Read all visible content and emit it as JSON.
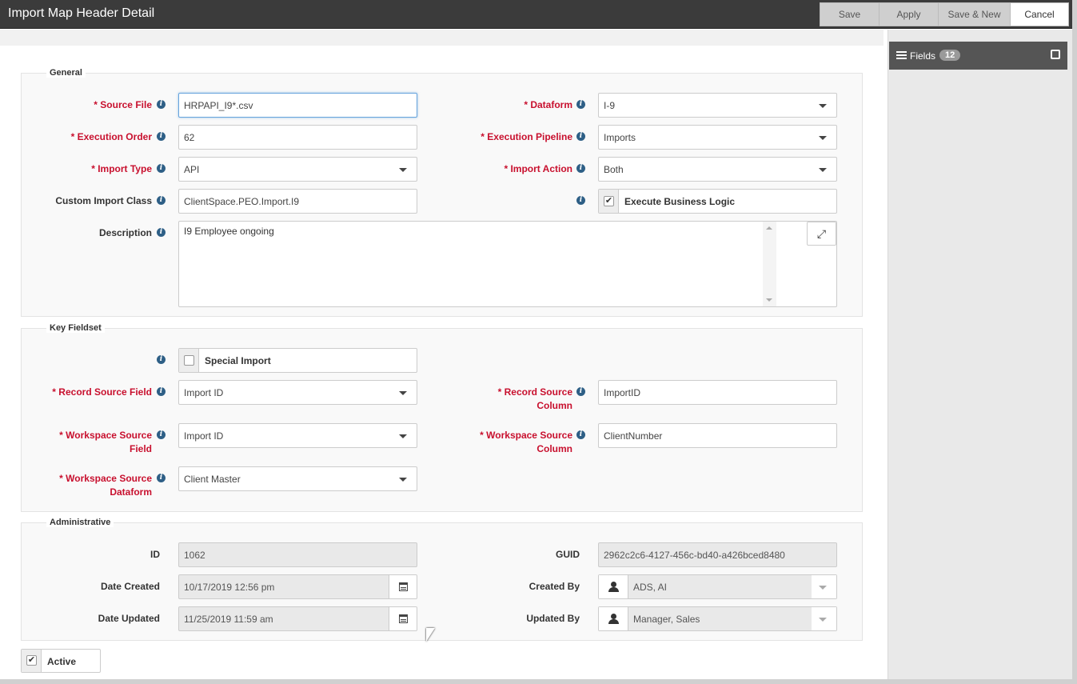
{
  "window": {
    "title": "Import Map Header Detail"
  },
  "toolbar": {
    "save": "Save",
    "apply": "Apply",
    "save_new": "Save & New",
    "cancel": "Cancel"
  },
  "side_panel": {
    "fields_label": "Fields",
    "fields_count": "12",
    "icons": [
      "list-icon",
      "popout-icon"
    ]
  },
  "general": {
    "legend": "General",
    "source_file": {
      "label": "* Source File",
      "value": "HRPAPI_I9*.csv"
    },
    "dataform": {
      "label": "* Dataform",
      "value": "I-9"
    },
    "execution_order": {
      "label": "* Execution Order",
      "value": "62"
    },
    "execution_pipeline": {
      "label": "* Execution Pipeline",
      "value": "Imports"
    },
    "import_type": {
      "label": "* Import Type",
      "value": "API"
    },
    "import_action": {
      "label": "* Import Action",
      "value": "Both"
    },
    "custom_import_class": {
      "label": "Custom Import Class",
      "value": "ClientSpace.PEO.Import.I9"
    },
    "execute_business_logic": {
      "label": "Execute Business Logic",
      "checked": true
    },
    "description": {
      "label": "Description",
      "value": "I9 Employee ongoing"
    }
  },
  "key_fieldset": {
    "legend": "Key Fieldset",
    "special_import": {
      "label": "Special Import",
      "checked": false
    },
    "record_source_field": {
      "label_line1": "* Record Source Field",
      "value": "Import ID"
    },
    "record_source_column": {
      "label_line1": "* Record Source",
      "label_line2": "Column",
      "value": "ImportID"
    },
    "workspace_source_field": {
      "label_line1": "* Workspace Source",
      "label_line2": "Field",
      "value": "Import ID"
    },
    "workspace_source_column": {
      "label_line1": "* Workspace Source",
      "label_line2": "Column",
      "value": "ClientNumber"
    },
    "workspace_source_dataform": {
      "label_line1": "* Workspace Source",
      "label_line2": "Dataform",
      "value": "Client Master"
    }
  },
  "administrative": {
    "legend": "Administrative",
    "id": {
      "label": "ID",
      "value": "1062"
    },
    "guid": {
      "label": "GUID",
      "value": "2962c2c6-4127-456c-bd40-a426bced8480"
    },
    "date_created": {
      "label": "Date Created",
      "value": "10/17/2019 12:56 pm"
    },
    "created_by": {
      "label": "Created By",
      "value": "ADS, AI"
    },
    "date_updated": {
      "label": "Date Updated",
      "value": "11/25/2019 11:59 am"
    },
    "updated_by": {
      "label": "Updated By",
      "value": "Manager, Sales"
    }
  },
  "active": {
    "label": "Active",
    "checked": true
  },
  "colors": {
    "required_label": "#c8102e",
    "info_icon": "#2e5f86",
    "titlebar": "#3b3b3b"
  }
}
